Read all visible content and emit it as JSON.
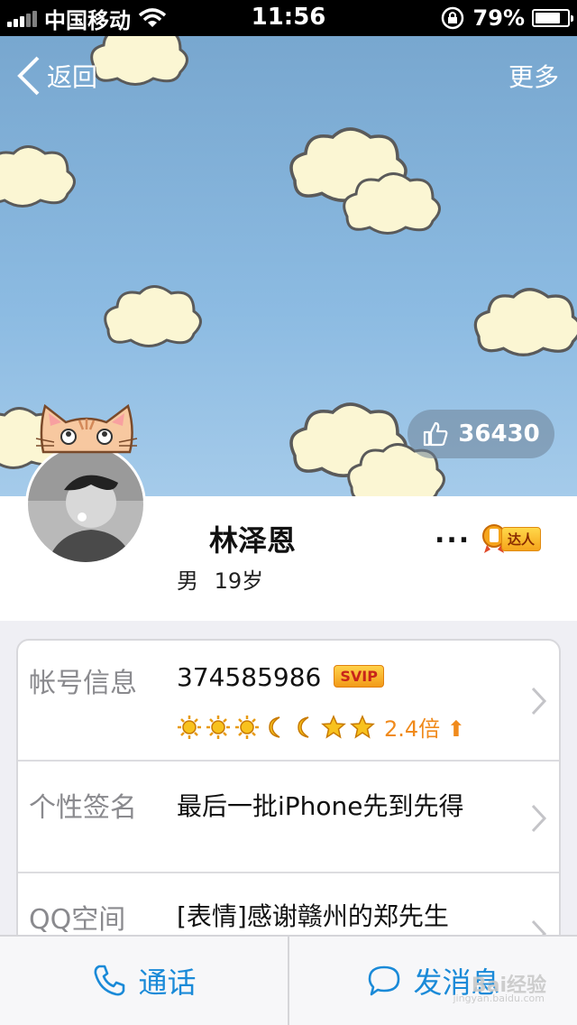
{
  "status_bar": {
    "carrier": "中国移动",
    "time": "11:56",
    "battery": "79%",
    "battery_level": 0.79
  },
  "nav": {
    "back_label": "返回",
    "more_label": "更多"
  },
  "likes": {
    "count": "36430"
  },
  "profile": {
    "name": "林泽恩",
    "more_dots": "...",
    "badge_label": "达人",
    "gender": "男",
    "age": "19岁"
  },
  "info": {
    "account": {
      "label": "帐号信息",
      "qq_number": "374585986",
      "vip_badge": "SVIP",
      "level_icons": [
        "sun",
        "sun",
        "sun",
        "moon",
        "moon",
        "star",
        "star"
      ],
      "multiplier": "2.4倍"
    },
    "signature": {
      "label": "个性签名",
      "text": "最后一批iPhone先到先得"
    },
    "qzone": {
      "label": "QQ空间",
      "text": "[表情]感谢赣州的郑先生"
    }
  },
  "bottom_bar": {
    "call_label": "通话",
    "message_label": "发消息"
  },
  "watermark": {
    "text": "Bai经验",
    "sub": "jingyan.baidu.com"
  },
  "colors": {
    "accent": "#1a8ad8",
    "sky": "#8cbbe2",
    "level_orange": "#f08a1c"
  }
}
